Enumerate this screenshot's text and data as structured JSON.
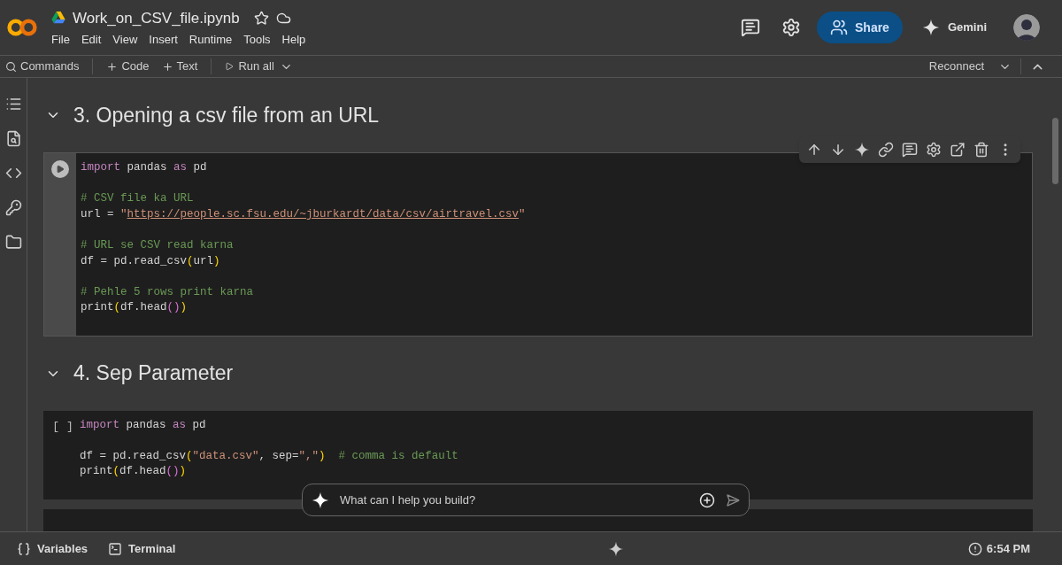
{
  "header": {
    "file_name": "Work_on_CSV_file.ipynb",
    "starred": false,
    "menu": [
      "File",
      "Edit",
      "View",
      "Insert",
      "Runtime",
      "Tools",
      "Help"
    ],
    "share_label": "Share",
    "gemini_label": "Gemini"
  },
  "toolbar": {
    "commands": "Commands",
    "add_code": "Code",
    "add_text": "Text",
    "run_all": "Run all",
    "connect": "Reconnect"
  },
  "sections": [
    {
      "heading": "3. Opening a csv file from an URL",
      "expanded": true,
      "cells": [
        {
          "selected": true,
          "blocks": [
            [
              [
                {
                  "kind": "keyword",
                  "text": "import"
                },
                {
                  "kind": "plain",
                  "text": " pandas "
                },
                {
                  "kind": "keyword",
                  "text": "as"
                },
                {
                  "kind": "plain",
                  "text": " pd"
                }
              ]
            ],
            [
              [
                {
                  "kind": "comment",
                  "text": "# CSV file ka URL"
                }
              ],
              [
                {
                  "kind": "plain",
                  "text": "url = "
                },
                {
                  "kind": "string",
                  "text": "\""
                },
                {
                  "kind": "link",
                  "text": "https://people.sc.fsu.edu/~jburkardt/data/csv/airtravel.csv"
                },
                {
                  "kind": "string",
                  "text": "\""
                }
              ]
            ],
            [
              [
                {
                  "kind": "comment",
                  "text": "# URL se CSV read karna"
                }
              ],
              [
                {
                  "kind": "plain",
                  "text": "df = pd.read_csv"
                },
                {
                  "kind": "bracket1",
                  "text": "("
                },
                {
                  "kind": "plain",
                  "text": "url"
                },
                {
                  "kind": "bracket1",
                  "text": ")"
                }
              ]
            ],
            [
              [
                {
                  "kind": "comment",
                  "text": "# Pehle 5 rows print karna"
                }
              ],
              [
                {
                  "kind": "plain",
                  "text": "print"
                },
                {
                  "kind": "bracket1",
                  "text": "("
                },
                {
                  "kind": "plain",
                  "text": "df.head"
                },
                {
                  "kind": "bracket2",
                  "text": "()"
                },
                {
                  "kind": "bracket1",
                  "text": ")"
                }
              ]
            ]
          ]
        }
      ]
    },
    {
      "heading": "4. Sep Parameter",
      "expanded": true,
      "cells": [
        {
          "selected": false,
          "prompt": "[ ]",
          "blocks": [
            [
              [
                {
                  "kind": "keyword",
                  "text": "import"
                },
                {
                  "kind": "plain",
                  "text": " pandas "
                },
                {
                  "kind": "keyword",
                  "text": "as"
                },
                {
                  "kind": "plain",
                  "text": " pd"
                }
              ]
            ],
            [
              [
                {
                  "kind": "plain",
                  "text": "df = pd.read_csv"
                },
                {
                  "kind": "bracket1",
                  "text": "("
                },
                {
                  "kind": "string",
                  "text": "\"data.csv\""
                },
                {
                  "kind": "plain",
                  "text": ", sep="
                },
                {
                  "kind": "string",
                  "text": "\",\""
                },
                {
                  "kind": "bracket1",
                  "text": ")"
                },
                {
                  "kind": "comment",
                  "text": "# comma is default"
                }
              ],
              [
                {
                  "kind": "plain",
                  "text": "print"
                },
                {
                  "kind": "bracket1",
                  "text": "("
                },
                {
                  "kind": "plain",
                  "text": "df.head"
                },
                {
                  "kind": "bracket2",
                  "text": "()"
                },
                {
                  "kind": "bracket1",
                  "text": ")"
                }
              ]
            ]
          ]
        }
      ]
    }
  ],
  "chat": {
    "placeholder": "What can I help you build?"
  },
  "status_bar": {
    "variables": "Variables",
    "terminal": "Terminal",
    "time": "6:54 PM"
  }
}
